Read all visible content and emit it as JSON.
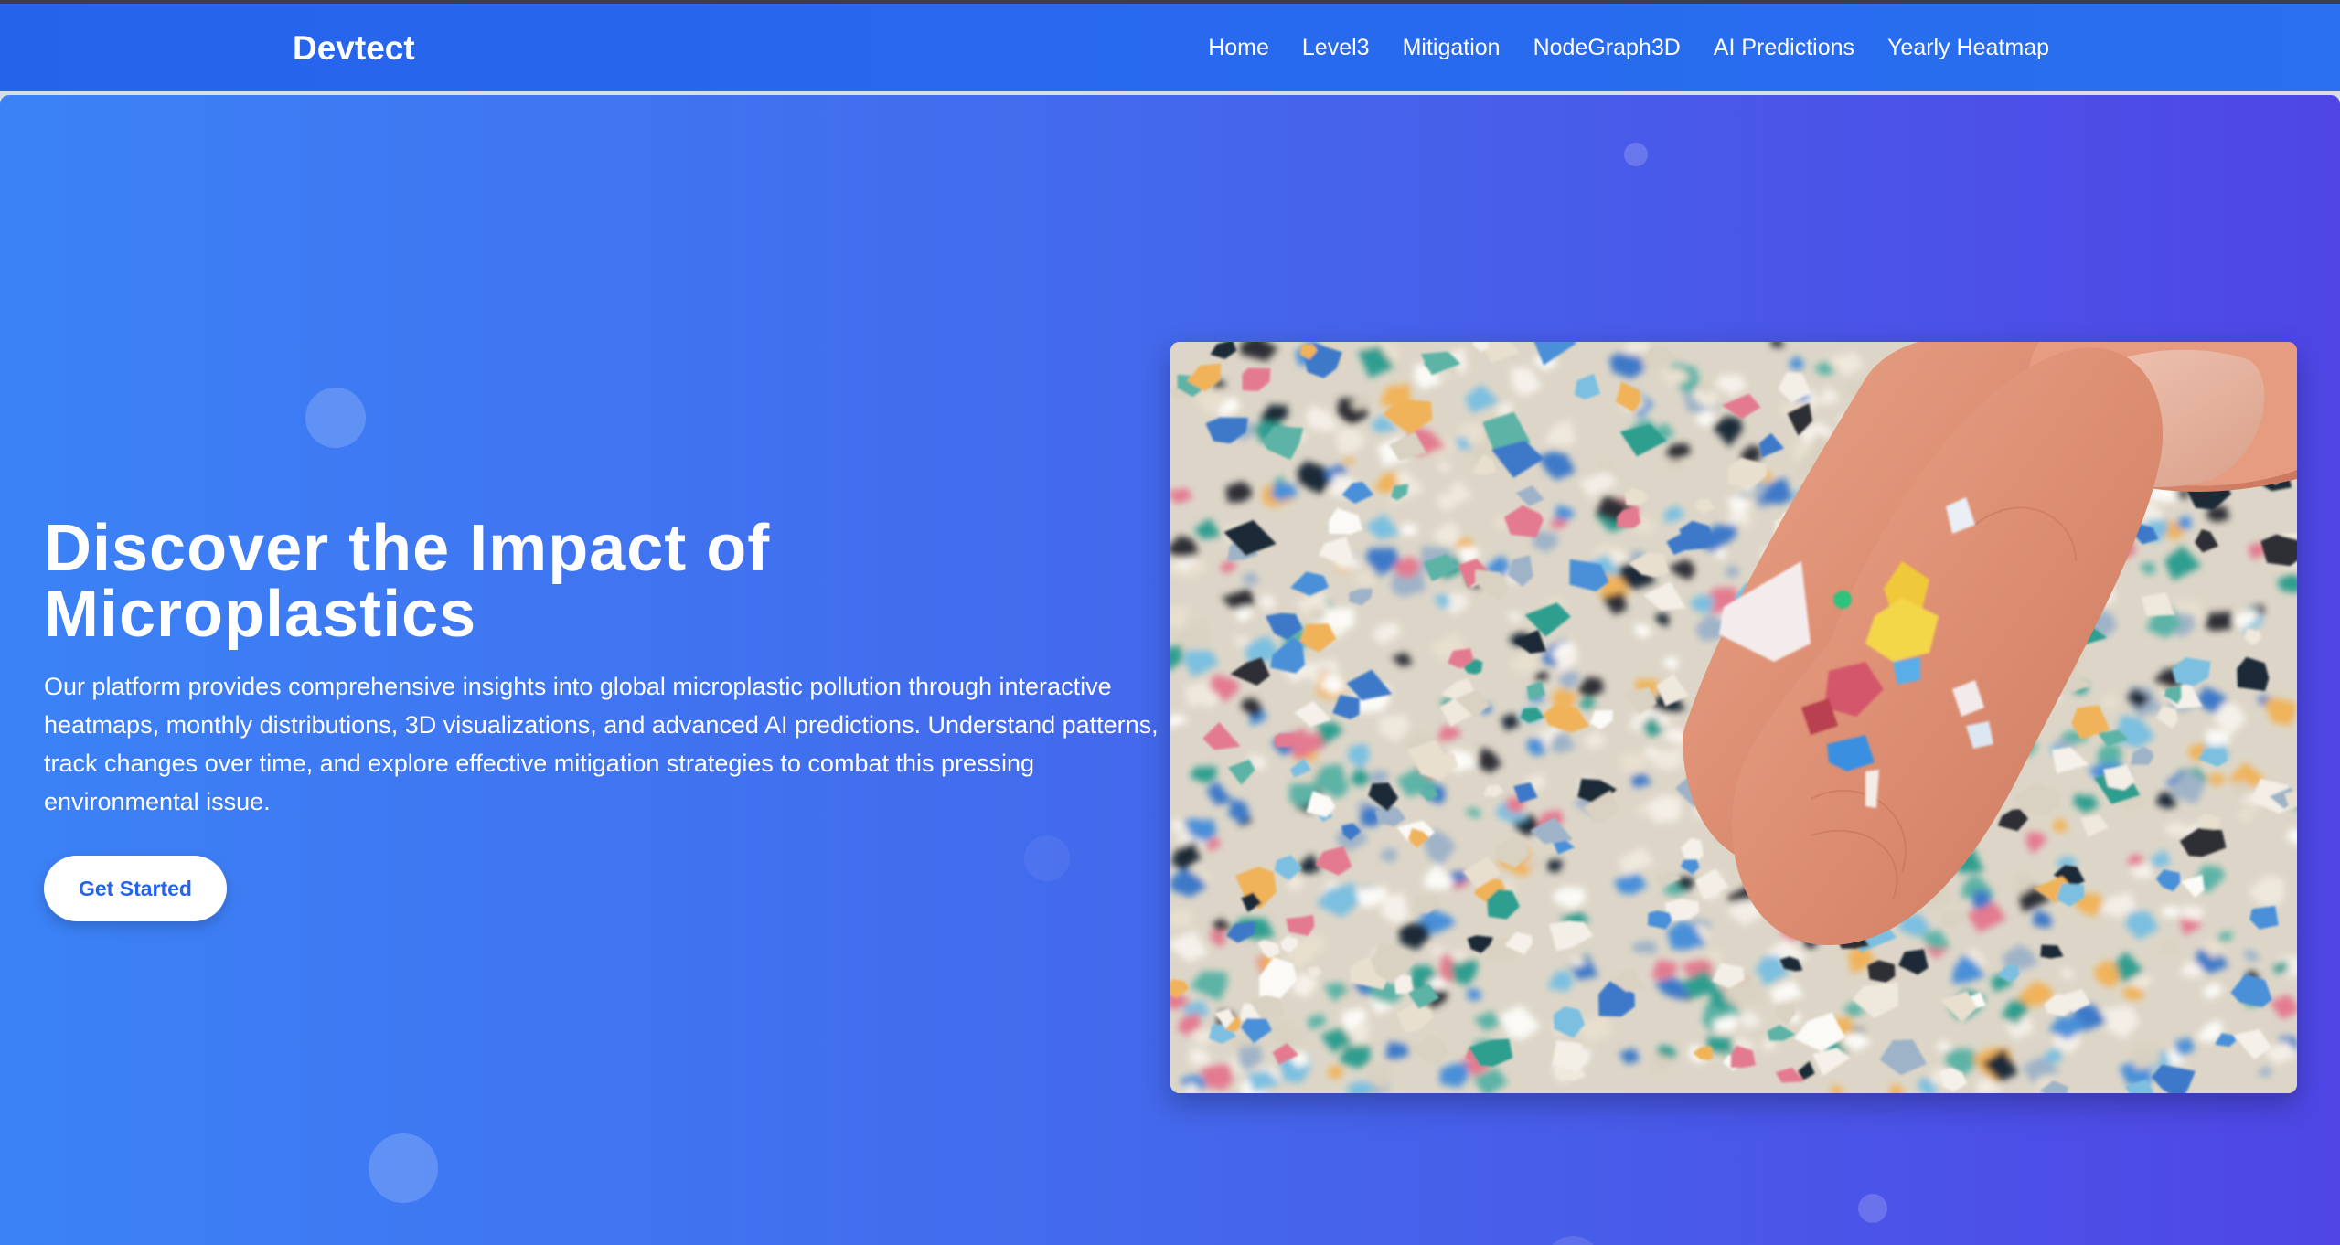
{
  "navbar": {
    "brand": "Devtect",
    "links": [
      {
        "label": "Home"
      },
      {
        "label": "Level3"
      },
      {
        "label": "Mitigation"
      },
      {
        "label": "NodeGraph3D"
      },
      {
        "label": "AI Predictions"
      },
      {
        "label": "Yearly Heatmap"
      }
    ]
  },
  "hero": {
    "title_line1": "Discover the Impact of",
    "title_line2": "Microplastics",
    "description": "Our platform provides comprehensive insights into global microplastic pollution through interactive heatmaps, monthly distributions, 3D visualizations, and advanced AI predictions. Understand patterns, track changes over time, and explore effective mitigation strategies to combat this pressing environmental issue.",
    "cta_label": "Get Started",
    "image_subject": "hand-holding-microplastic-fragments"
  },
  "colors": {
    "navbar": "#2563eb",
    "hero_gradient_start": "#3b82f6",
    "hero_gradient_end": "#4f46e5",
    "cta_text": "#2563eb",
    "white": "#ffffff"
  }
}
